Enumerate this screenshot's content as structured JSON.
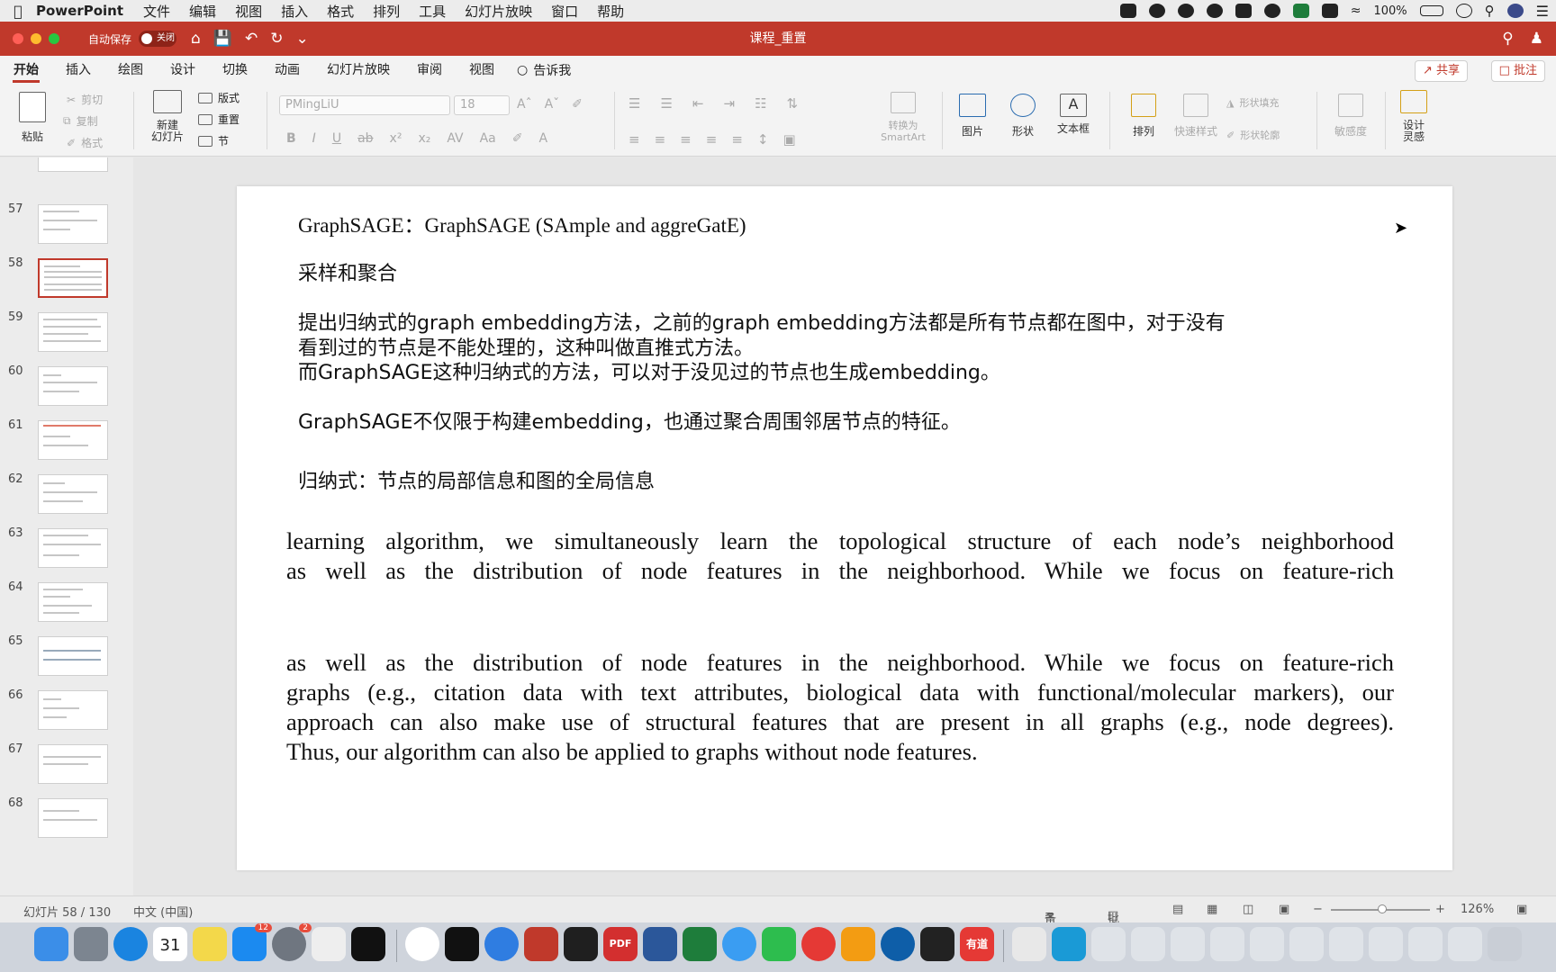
{
  "menubar": {
    "app_name": "PowerPoint",
    "items": [
      "文件",
      "编辑",
      "视图",
      "插入",
      "格式",
      "排列",
      "工具",
      "幻灯片放映",
      "窗口",
      "帮助"
    ],
    "battery": "100%"
  },
  "titlebar": {
    "autosave_label": "自动保存",
    "autosave_state": "关闭",
    "doc_title": "课程_重置"
  },
  "ribbon_tabs": {
    "tabs": [
      "开始",
      "插入",
      "绘图",
      "设计",
      "切换",
      "动画",
      "幻灯片放映",
      "审阅",
      "视图"
    ],
    "active": "开始",
    "tell_me": "告诉我",
    "share": "共享",
    "comments": "批注"
  },
  "ribbon": {
    "paste": "粘贴",
    "cut": "剪切",
    "copy": "复制",
    "format": "格式",
    "new_slide_line1": "新建",
    "new_slide_line2": "幻灯片",
    "layout": "版式",
    "reset": "重置",
    "section": "节",
    "font_name": "PMingLiU",
    "font_size": "18",
    "smartart_line1": "转换为",
    "smartart_line2": "SmartArt",
    "picture": "图片",
    "shape": "形状",
    "textbox": "文本框",
    "arrange": "排列",
    "quick_styles": "快速样式",
    "shape_fill": "形状填充",
    "shape_outline": "形状轮廓",
    "sensitivity": "敏感度",
    "designer_line1": "设计",
    "designer_line2": "灵感"
  },
  "thumbnails": {
    "numbers": [
      "57",
      "58",
      "59",
      "60",
      "61",
      "62",
      "63",
      "64",
      "65",
      "66",
      "67",
      "68"
    ],
    "selected": "58"
  },
  "slide": {
    "title_line": "GraphSAGE：GraphSAGE (SAmple and aggreGatE)",
    "subtitle": "采样和聚合",
    "line1": "提出归纳式的graph embedding方法，之前的graph embedding方法都是所有节点都在图中，对于没有",
    "line2": "看到过的节点是不能处理的，这种叫做直推式方法。",
    "line3": "而GraphSAGE这种归纳式的方法，可以对于没见过的节点也生成embedding。",
    "line4": "GraphSAGE不仅限于构建embedding，也通过聚合周围邻居节点的特征。",
    "line5": "归纳式：节点的局部信息和图的全局信息",
    "excerpt1": [
      "learning algorithm, we simultaneously learn the topological structure of each node’s neighborhood",
      "as well as the distribution of node features in the neighborhood.  While we focus on feature-rich"
    ],
    "excerpt2": [
      "as well as the distribution of node features in the neighborhood.  While we focus on feature-rich",
      "graphs (e.g., citation data with text attributes, biological data with functional/molecular markers), our",
      "approach can also make use of structural features that are present in all graphs (e.g., node degrees).",
      "Thus, our algorithm can also be applied to graphs without node features."
    ]
  },
  "statusbar": {
    "slide_count": "幻灯片 58 / 130",
    "language": "中文 (中国)",
    "notes": "备注",
    "comments": "批注",
    "zoom": "126%"
  },
  "dock": {
    "calendar_day": "31",
    "badge_appstore": "12",
    "badge_settings": "2",
    "pdf": "PDF",
    "youdao": "有道"
  },
  "colors": {
    "accent": "#c0392b",
    "ribbon_bg": "#f3f3f3",
    "canvas_bg": "#e6e6e6"
  }
}
